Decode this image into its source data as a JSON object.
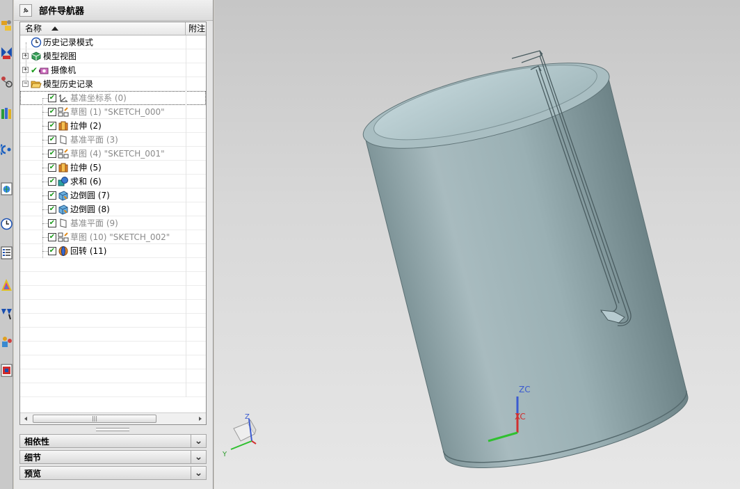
{
  "navigator": {
    "title": "部件导航器",
    "columns": {
      "name": "名称",
      "note": "附注"
    },
    "tree": [
      {
        "label": "历史记录模式",
        "icon": "clock-icon",
        "gray": false
      },
      {
        "label": "模型视图",
        "icon": "model-view-icon",
        "gray": false,
        "expand": "+"
      },
      {
        "label": "摄像机",
        "icon": "camera-icon",
        "gray": false,
        "expand": "+"
      },
      {
        "label": "模型历史记录",
        "icon": "folder-open-icon",
        "gray": false,
        "expand": "−"
      },
      {
        "label": "基准坐标系 (0)",
        "icon": "datum-csys-icon",
        "gray": true,
        "checked": true
      },
      {
        "label": "草图 (1) \"SKETCH_000\"",
        "icon": "sketch-icon",
        "gray": true,
        "checked": true
      },
      {
        "label": "拉伸 (2)",
        "icon": "extrude-icon",
        "gray": false,
        "checked": true
      },
      {
        "label": "基准平面 (3)",
        "icon": "datum-plane-icon",
        "gray": true,
        "checked": true
      },
      {
        "label": "草图 (4) \"SKETCH_001\"",
        "icon": "sketch-icon",
        "gray": true,
        "checked": true
      },
      {
        "label": "拉伸 (5)",
        "icon": "extrude-icon",
        "gray": false,
        "checked": true
      },
      {
        "label": "求和 (6)",
        "icon": "unite-icon",
        "gray": false,
        "checked": true
      },
      {
        "label": "边倒圆 (7)",
        "icon": "edge-blend-icon",
        "gray": false,
        "checked": true
      },
      {
        "label": "边倒圆 (8)",
        "icon": "edge-blend-icon",
        "gray": false,
        "checked": true
      },
      {
        "label": "基准平面 (9)",
        "icon": "datum-plane-icon",
        "gray": true,
        "checked": true
      },
      {
        "label": "草图 (10) \"SKETCH_002\"",
        "icon": "sketch-icon",
        "gray": true,
        "checked": true
      },
      {
        "label": "回转 (11)",
        "icon": "revolve-icon",
        "gray": false,
        "checked": true
      }
    ],
    "panels": [
      "相依性",
      "细节",
      "预览"
    ]
  },
  "viewport": {
    "axes": {
      "z": "Z",
      "y": "Y",
      "zc": "ZC",
      "xc": "XC"
    }
  },
  "colors": {
    "body": "#9fb2b6",
    "body_dark": "#6f8589",
    "check": "#1a9a1a"
  }
}
